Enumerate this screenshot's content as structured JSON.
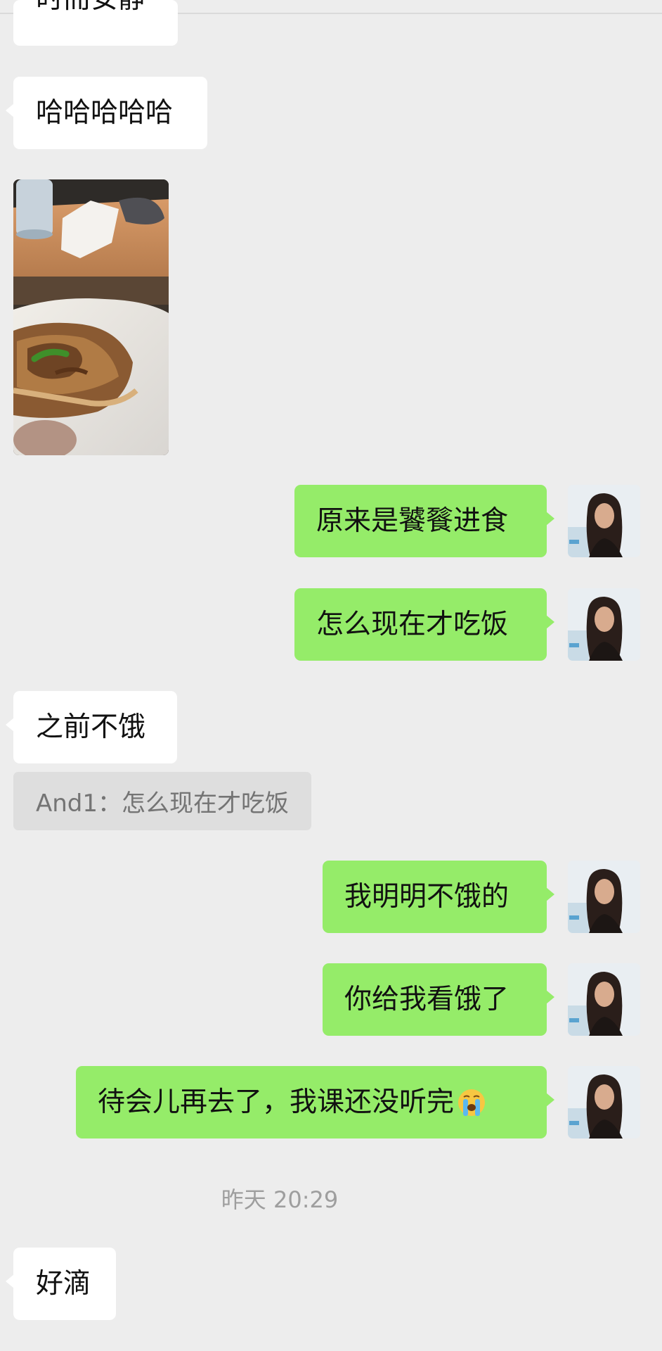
{
  "chat": {
    "messages": [
      {
        "side": "in",
        "type": "text",
        "text": "时而安静"
      },
      {
        "side": "in",
        "type": "text",
        "text": "哈哈哈哈哈"
      },
      {
        "side": "in",
        "type": "image",
        "icon": "food-photo"
      },
      {
        "side": "out",
        "type": "text",
        "text": "原来是饕餮进食"
      },
      {
        "side": "out",
        "type": "text",
        "text": "怎么现在才吃饭"
      },
      {
        "side": "in",
        "type": "text",
        "text": "之前不饿",
        "quote": "And1：怎么现在才吃饭"
      },
      {
        "side": "out",
        "type": "text",
        "text": "我明明不饿的"
      },
      {
        "side": "out",
        "type": "text",
        "text": "你给我看饿了"
      },
      {
        "side": "out",
        "type": "text",
        "text": "待会儿再去了，我课还没听完",
        "emoji": "loudly-crying-face-icon"
      }
    ],
    "timestamp": "昨天 20:29",
    "last_message": {
      "side": "in",
      "type": "text",
      "text": "好滴"
    }
  },
  "colors": {
    "background": "#ededed",
    "incoming_bubble": "#ffffff",
    "outgoing_bubble": "#95ec69",
    "quote_background": "#dedede",
    "timestamp_text": "#9e9e9e"
  }
}
